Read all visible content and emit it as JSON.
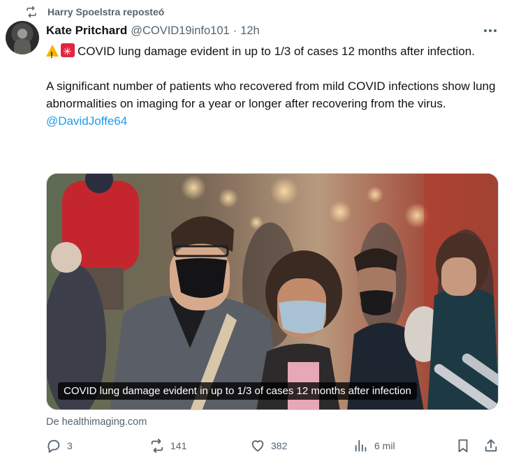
{
  "repost": {
    "label": "Harry Spoelstra reposteó",
    "icon": "repost-icon"
  },
  "author": {
    "name": "Kate Pritchard",
    "handle": "@COVID19info101",
    "separator": "·",
    "time": "12h"
  },
  "tweet": {
    "headline": "COVID lung damage evident in up to 1/3 of cases 12 months after infection.",
    "paragraph": "A significant number of patients who recovered from mild COVID infections show lung abnormalities on imaging for a year or longer after recovering from the virus.",
    "mention": "@DavidJoffe64",
    "emojis": [
      "warning-icon",
      "siren-icon"
    ]
  },
  "card": {
    "caption": "COVID lung damage evident in up to 1/3 of cases 12 months after infection",
    "source": "De healthimaging.com"
  },
  "actions": {
    "replies": "3",
    "reposts": "141",
    "likes": "382",
    "views": "6 mil"
  },
  "colors": {
    "accent": "#1d9bf0",
    "muted": "#536471",
    "text": "#0f1419"
  }
}
